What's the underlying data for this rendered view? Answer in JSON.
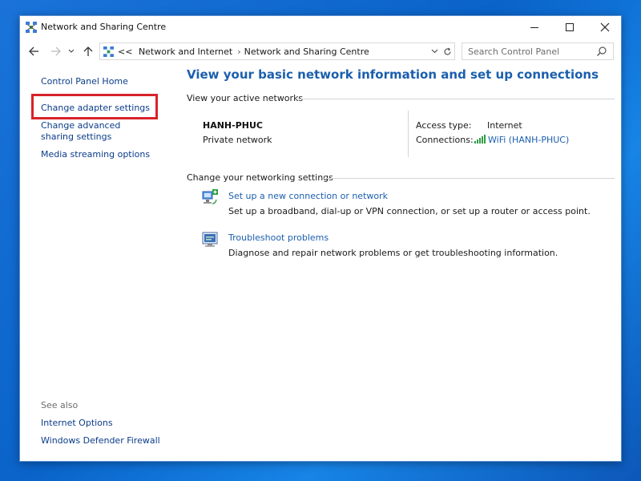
{
  "window": {
    "title": "Network and Sharing Centre"
  },
  "navbar": {
    "breadcrumb_root": "<<",
    "breadcrumbs": [
      "Network and Internet",
      "Network and Sharing Centre"
    ],
    "search_placeholder": "Search Control Panel"
  },
  "sidebar": {
    "home": "Control Panel Home",
    "adapter": "Change adapter settings",
    "advanced": "Change advanced sharing settings",
    "media": "Media streaming options",
    "see_also": "See also",
    "internet_options": "Internet Options",
    "firewall": "Windows Defender Firewall"
  },
  "main": {
    "title": "View your basic network information and set up connections",
    "active_networks_heading": "View your active networks",
    "network": {
      "name": "HANH-PHUC",
      "type": "Private network",
      "access_type_label": "Access type:",
      "access_type_value": "Internet",
      "connections_label": "Connections:",
      "connection_link": "WiFi (HANH-PHUC)"
    },
    "settings_heading": "Change your networking settings",
    "tasks": [
      {
        "link": "Set up a new connection or network",
        "description": "Set up a broadband, dial-up or VPN connection, or set up a router or access point."
      },
      {
        "link": "Troubleshoot problems",
        "description": "Diagnose and repair network problems or get troubleshooting information."
      }
    ]
  },
  "colors": {
    "link": "#1b5fae",
    "sidebar_link": "#0b3c8a",
    "highlight": "#d8232a",
    "desktop": "#0a63c9"
  },
  "icons": {
    "app": "network-center-icon",
    "wifi": "wifi-signal-icon",
    "new_connection": "new-connection-icon",
    "troubleshoot": "troubleshoot-icon"
  }
}
